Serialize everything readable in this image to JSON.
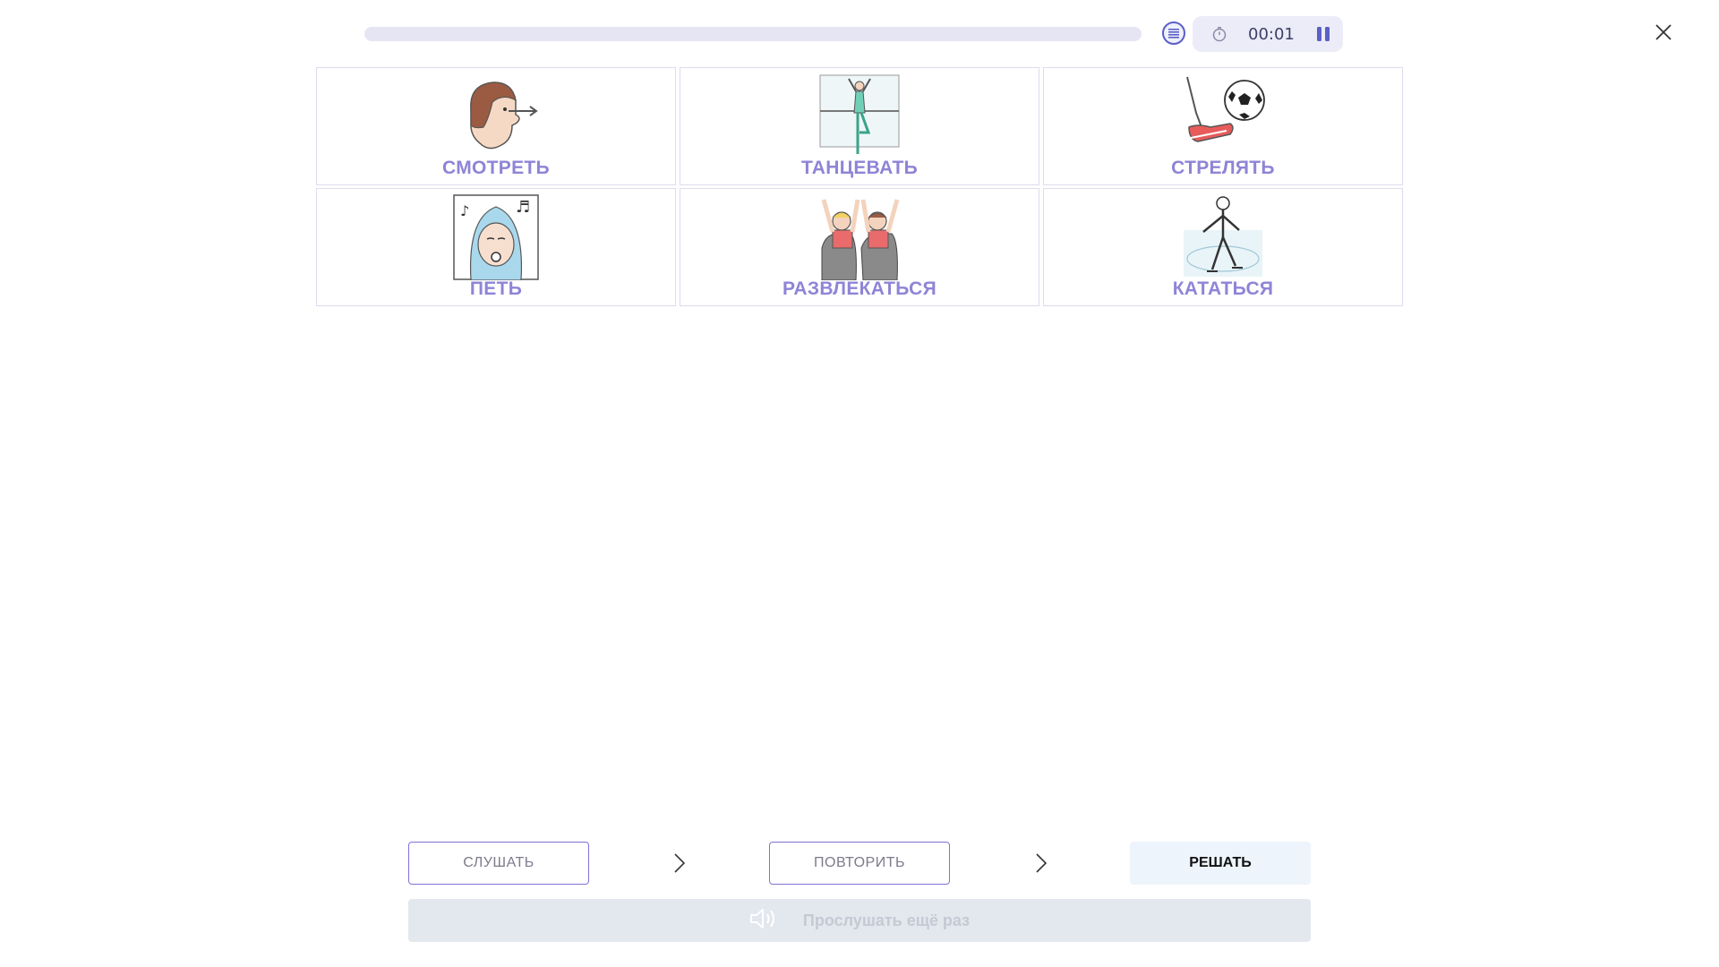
{
  "progress": {
    "fraction": 0.0
  },
  "timer": {
    "time": "00:01"
  },
  "cards": [
    {
      "label": "СМОТРЕТЬ",
      "icon": "look-icon"
    },
    {
      "label": "ТАНЦЕВАТЬ",
      "icon": "dance-icon"
    },
    {
      "label": "СТРЕЛЯТЬ",
      "icon": "kick-ball-icon"
    },
    {
      "label": "ПЕТЬ",
      "icon": "sing-icon"
    },
    {
      "label": "РАЗВЛЕКАТЬСЯ",
      "icon": "have-fun-icon"
    },
    {
      "label": "КАТАТЬСЯ",
      "icon": "skate-icon"
    }
  ],
  "steps": {
    "listen": "СЛУШАТЬ",
    "repeat": "ПОВТОРИТЬ",
    "solve": "РЕШАТЬ"
  },
  "replay": {
    "label": "Прослушать ещё раз",
    "icon": "speaker-icon"
  },
  "colors": {
    "accent": "#8e84d6",
    "border_accent": "#7f72d6",
    "track": "#e6e5f3",
    "timer_bg": "#ececf8",
    "solve_bg": "#eef4fb",
    "replay_bg": "#e3e7ee"
  }
}
